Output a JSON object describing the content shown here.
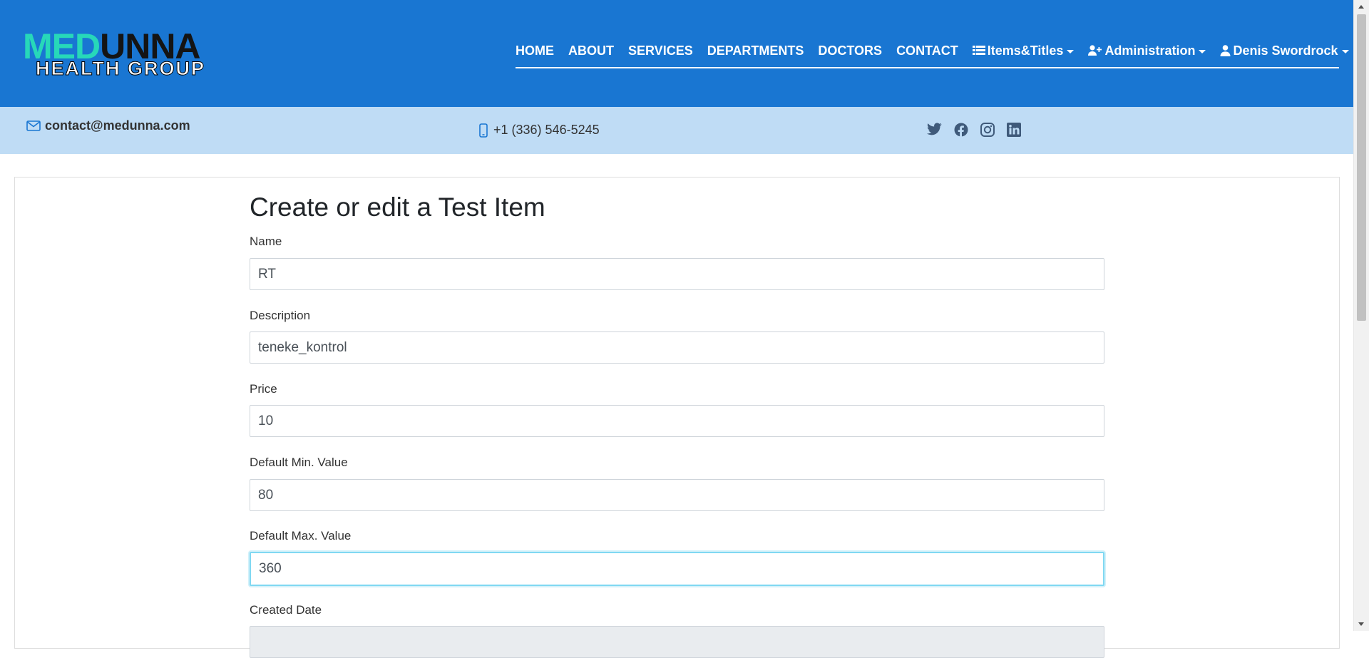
{
  "header": {
    "logo_top_med": "MED",
    "logo_top_unna": "UNNA",
    "logo_bottom": "HEALTH GROUP",
    "nav": {
      "home": "HOME",
      "about": "ABOUT",
      "services": "SERVICES",
      "departments": "DEPARTMENTS",
      "doctors": "DOCTORS",
      "contact": "CONTACT",
      "items_titles": "Items&Titles",
      "administration": "Administration",
      "user": "Denis Swordrock"
    }
  },
  "topbar": {
    "email": "contact@medunna.com",
    "phone": "+1 (336) 546-5245",
    "social_icons": [
      "twitter-icon",
      "facebook-icon",
      "instagram-icon",
      "linkedin-icon"
    ]
  },
  "form": {
    "title": "Create or edit a Test Item",
    "name": {
      "label": "Name",
      "value": "RT"
    },
    "description": {
      "label": "Description",
      "value": "teneke_kontrol"
    },
    "price": {
      "label": "Price",
      "value": "10"
    },
    "default_min": {
      "label": "Default Min. Value",
      "value": "80"
    },
    "default_max": {
      "label": "Default Max. Value",
      "value": "360"
    },
    "created_date": {
      "label": "Created Date",
      "value": ""
    }
  },
  "colors": {
    "header_bg": "#1976d2",
    "topbar_bg": "#bfdcf5",
    "logo_med": "#27d8b9",
    "focus_border": "#80d8f2"
  }
}
